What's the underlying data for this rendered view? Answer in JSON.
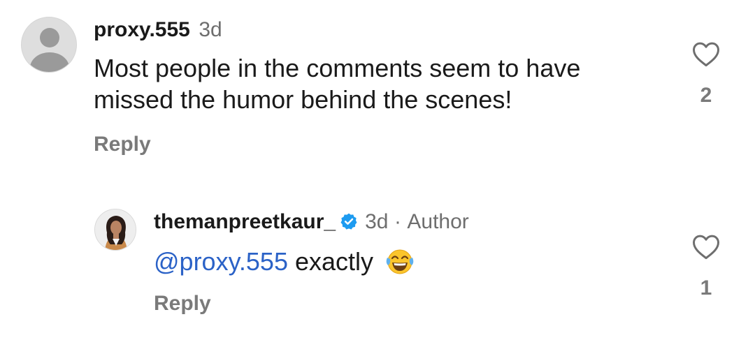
{
  "comments": [
    {
      "username": "proxy.555",
      "time": "3d",
      "text": "Most people in the comments seem to have missed the humor behind the scenes!",
      "reply_label": "Reply",
      "like_count": "2",
      "avatar_icon": "default-avatar-icon"
    },
    {
      "username": "themanpreetkaur_",
      "verified_icon": "verified-badge-icon",
      "time": "3d",
      "separator": "·",
      "author_label": "Author",
      "mention": "@proxy.555",
      "text": "exactly",
      "emoji_icon": "face-with-tears-of-joy-icon",
      "reply_label": "Reply",
      "like_count": "1"
    }
  ],
  "colors": {
    "mention": "#2b62c7",
    "verified": "#1d9bf0",
    "muted": "#7a7a7a"
  }
}
